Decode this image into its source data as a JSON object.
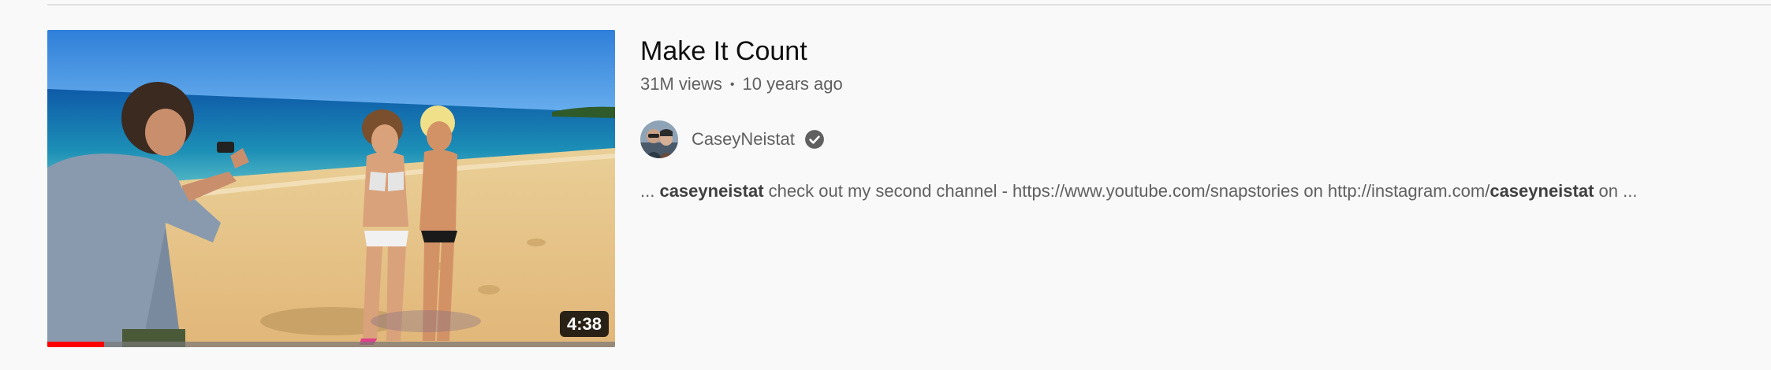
{
  "video": {
    "title": "Make It Count",
    "views": "31M views",
    "separator": "•",
    "age": "10 years ago",
    "duration": "4:38",
    "watch_progress": 0.1,
    "thumbnail_icon": "beach-photo-thumbnail"
  },
  "channel": {
    "name": "CaseyNeistat",
    "verified_icon": "verified-check-icon"
  },
  "snippet": {
    "parts": [
      {
        "text": "... ",
        "bold": false
      },
      {
        "text": "caseyneistat",
        "bold": true
      },
      {
        "text": " check out my second channel - https://www.youtube.com/snapstories on http://instagram.com/",
        "bold": false
      },
      {
        "text": "caseyneistat",
        "bold": true
      },
      {
        "text": " on ...",
        "bold": false
      }
    ]
  },
  "colors": {
    "progress": "#ff0000",
    "title": "#0f0f0f",
    "meta": "#606060",
    "background": "#f9f9f9"
  }
}
